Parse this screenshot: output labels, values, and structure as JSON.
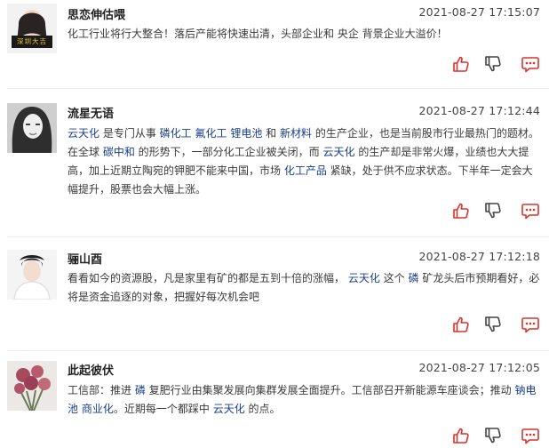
{
  "comments": [
    {
      "user": "思恋伸估喂",
      "time": "2021-08-27 17:15:07",
      "avatar_badge": "深圳大吉",
      "segments": [
        {
          "t": "化工行业将行大整合！落后产能将快速出清，头部企业和 央企 背景企业大溢价！"
        }
      ]
    },
    {
      "user": "流星无语",
      "time": "2021-08-27 17:12:44",
      "segments": [
        {
          "t": "云天化",
          "link": true
        },
        {
          "t": " 是专门从事 "
        },
        {
          "t": "磷化工",
          "link": true
        },
        {
          "t": " "
        },
        {
          "t": "氟化工",
          "link": true
        },
        {
          "t": " "
        },
        {
          "t": "锂电池",
          "link": true
        },
        {
          "t": " 和 "
        },
        {
          "t": "新材料",
          "link": true
        },
        {
          "t": " 的生产企业，也是当前股市行业最热门的题材。在全球 "
        },
        {
          "t": "碳中和",
          "link": true
        },
        {
          "t": " 的形势下，一部分化工企业被关闭，而 "
        },
        {
          "t": "云天化",
          "link": true
        },
        {
          "t": " 的生产却是非常火爆，业绩也大大提高，加上近期立陶宛的钾肥不能来中国，市场 "
        },
        {
          "t": "化工产品",
          "link": true
        },
        {
          "t": " 紧缺，处于供不应求状态。下半年一定会大幅提升，股票也会大幅上涨。"
        }
      ]
    },
    {
      "user": "骊山酉",
      "time": "2021-08-27 17:12:18",
      "segments": [
        {
          "t": "看看如今的资源股，凡是家里有矿的都是五到十倍的涨幅， "
        },
        {
          "t": "云天化",
          "link": true
        },
        {
          "t": " 这个 "
        },
        {
          "t": "磷",
          "link": true
        },
        {
          "t": " 矿龙头后市预期看好，必将是资金追逐的对象，把握好每次机会吧"
        }
      ]
    },
    {
      "user": "此起彼伏",
      "time": "2021-08-27 17:12:05",
      "segments": [
        {
          "t": "工信部：推进 "
        },
        {
          "t": "磷",
          "link": true
        },
        {
          "t": " 复肥行业由集聚发展向集群发展全面提升。工信部召开新能源车座谈会；推动 "
        },
        {
          "t": "钠电池",
          "link": true
        },
        {
          "t": " "
        },
        {
          "t": "商业化",
          "link": true
        },
        {
          "t": "。近期每一个都踩中 "
        },
        {
          "t": "云天化",
          "link": true
        },
        {
          "t": " 的点。"
        }
      ]
    }
  ],
  "icons": {
    "like": "thumbs-up-icon",
    "dislike": "thumbs-down-icon",
    "reply": "speech-bubble-icon"
  },
  "colors": {
    "icon_red": "#d9342b",
    "link_blue": "#1a3f8f",
    "separator": "#ececec"
  }
}
